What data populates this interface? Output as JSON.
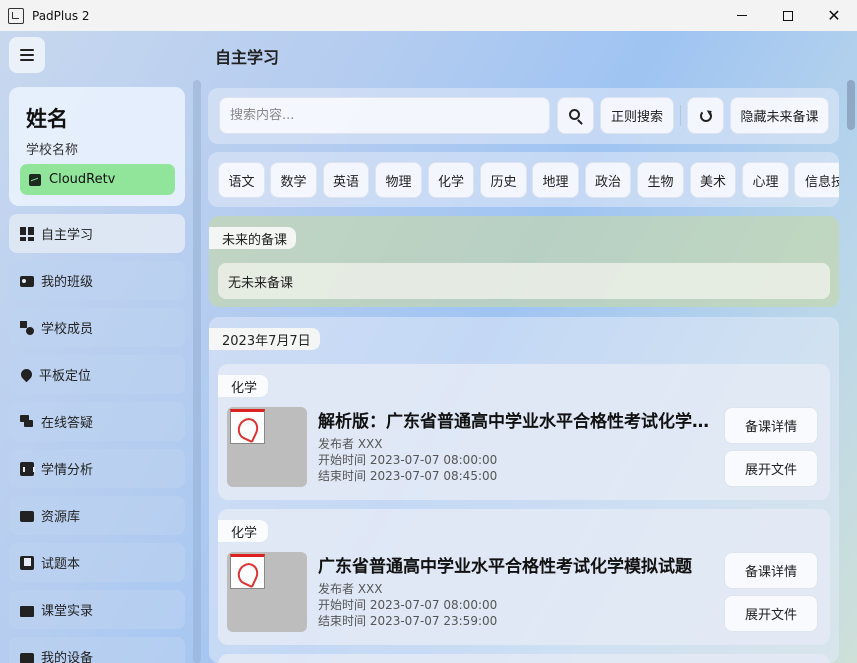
{
  "window": {
    "title": "PadPlus 2"
  },
  "header": {
    "page_title": "自主学习"
  },
  "profile": {
    "name": "姓名",
    "school": "学校名称",
    "cloud_label": "CloudRetv"
  },
  "sidebar": {
    "items": [
      {
        "label": "自主学习",
        "icon": "dashboard-icon",
        "active": true
      },
      {
        "label": "我的班级",
        "icon": "id-card-icon"
      },
      {
        "label": "学校成员",
        "icon": "shapes-icon"
      },
      {
        "label": "平板定位",
        "icon": "location-pin-icon"
      },
      {
        "label": "在线答疑",
        "icon": "chat-icon"
      },
      {
        "label": "学情分析",
        "icon": "bar-chart-icon"
      },
      {
        "label": "资源库",
        "icon": "folder-icon"
      },
      {
        "label": "试题本",
        "icon": "book-icon"
      },
      {
        "label": "课堂实录",
        "icon": "clapperboard-icon"
      },
      {
        "label": "我的设备",
        "icon": "device-icon"
      }
    ]
  },
  "search": {
    "placeholder": "搜索内容...",
    "regex_label": "正则搜索",
    "hide_future_label": "隐藏未来备课"
  },
  "subjects": [
    "语文",
    "数学",
    "英语",
    "物理",
    "化学",
    "历史",
    "地理",
    "政治",
    "生物",
    "美术",
    "心理",
    "信息技术"
  ],
  "future": {
    "title": "未来的备课",
    "empty_text": "无未来备课"
  },
  "date_group": {
    "date": "2023年7月7日",
    "lessons": [
      {
        "subject": "化学",
        "title": "解析版：广东省普通高中学业水平合格性考试化学模拟试题",
        "publisher": "发布者 XXX",
        "start": "开始时间 2023-07-07 08:00:00",
        "end": "结束时间 2023-07-07 08:45:00",
        "detail_label": "备课详情",
        "expand_label": "展开文件"
      },
      {
        "subject": "化学",
        "title": "广东省普通高中学业水平合格性考试化学模拟试题",
        "publisher": "发布者 XXX",
        "start": "开始时间 2023-07-07 08:00:00",
        "end": "结束时间 2023-07-07 23:59:00",
        "detail_label": "备课详情",
        "expand_label": "展开文件"
      }
    ]
  },
  "colors": {
    "cloud_button": "#90e59b",
    "future_card": "#c4d7aa"
  }
}
